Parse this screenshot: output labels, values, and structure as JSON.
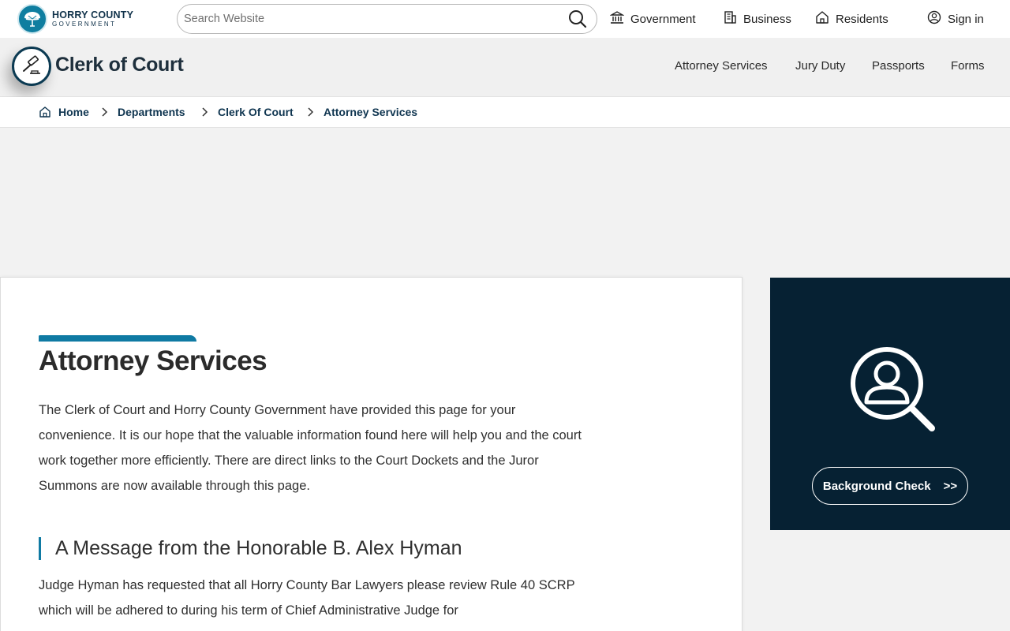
{
  "topbar": {
    "logo": {
      "line1": "HORRY COUNTY",
      "line2": "GOVERNMENT"
    },
    "search": {
      "placeholder": "Search Website",
      "icon": "search-icon"
    },
    "nav": [
      {
        "label": "Government",
        "icon": "government-building-icon"
      },
      {
        "label": "Business",
        "icon": "office-building-icon"
      },
      {
        "label": "Residents",
        "icon": "home-icon"
      },
      {
        "label": "Sign in",
        "icon": "user-circle-icon"
      }
    ]
  },
  "section": {
    "icon": "gavel-icon",
    "title": "Clerk of Court",
    "nav": [
      "Attorney Services",
      "Jury Duty",
      "Passports",
      "Forms"
    ]
  },
  "breadcrumb": [
    "Home",
    "Departments",
    "Clerk Of Court",
    "Attorney Services"
  ],
  "main": {
    "title": "Attorney Services",
    "intro": "The Clerk of Court and Horry County Government have provided this page for your convenience. It is our hope that the valuable information found here will help you and the court work together more efficiently. There are direct links to the Court Dockets and the Juror Summons are now available through this page.",
    "message_heading": "A Message from the Honorable B. Alex Hyman",
    "message_body": "Judge Hyman has requested that all Horry County Bar Lawyers please review Rule 40 SCRP which will be adhered to during his term of Chief Administrative Judge for"
  },
  "sidebar": {
    "icon": "person-search-icon",
    "button_label": "Background Check",
    "button_arrow": ">>"
  },
  "colors": {
    "accent": "#0f7aa3",
    "dark_navy": "#062133",
    "breadcrumb_text": "#0f3550"
  }
}
